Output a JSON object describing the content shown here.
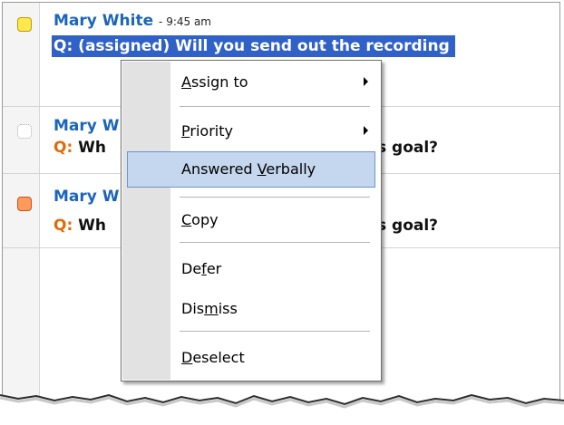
{
  "messages": [
    {
      "author": "Mary White",
      "time": "- 9:45 am",
      "prefix": "Q:",
      "question": "(assigned) Will you send out the recording",
      "flag_color": "#ffe84d",
      "selected": true
    },
    {
      "author": "Mary W",
      "prefix": "Q:",
      "question_start": "Wh",
      "question_end": "s goal?",
      "flag_color": "#ffffff"
    },
    {
      "author": "Mary W",
      "prefix": "Q:",
      "question_start": "Wh",
      "question_end": "s goal?",
      "flag_color": "#ff9a5a"
    }
  ],
  "context_menu": {
    "items": [
      {
        "pre": "",
        "key": "A",
        "post": "ssign to",
        "submenu": true
      },
      {
        "pre": "",
        "key": "P",
        "post": "riority",
        "submenu": true
      },
      {
        "pre": "Answered ",
        "key": "V",
        "post": "erbally",
        "highlighted": true
      },
      {
        "pre": "",
        "key": "C",
        "post": "opy"
      },
      {
        "pre": "De",
        "key": "f",
        "post": "er"
      },
      {
        "pre": "Dis",
        "key": "m",
        "post": "iss"
      },
      {
        "pre": "",
        "key": "D",
        "post": "eselect"
      }
    ]
  },
  "colors": {
    "author": "#1b66ba",
    "question_prefix": "#e06b06",
    "selection": "#2f61c7",
    "menu_highlight": "#c4d7ee"
  }
}
